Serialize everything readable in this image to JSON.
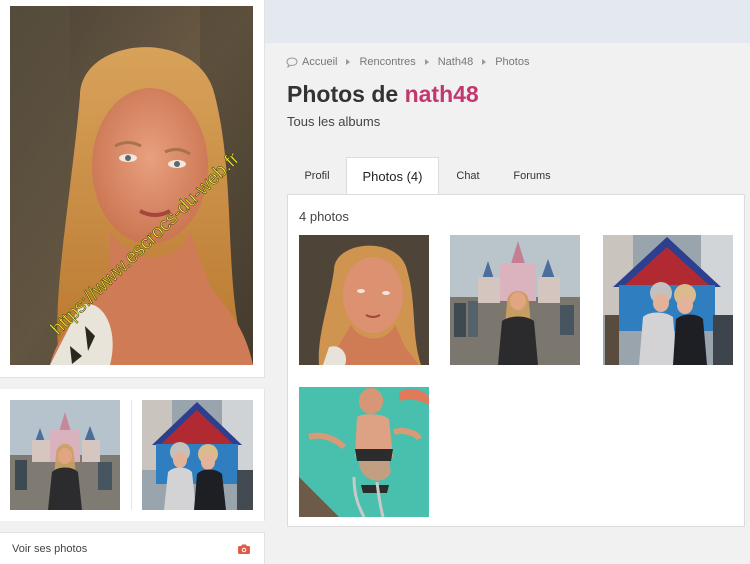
{
  "breadcrumb": [
    {
      "label": "Accueil"
    },
    {
      "label": "Rencontres"
    },
    {
      "label": "Nath48"
    },
    {
      "label": "Photos"
    }
  ],
  "page": {
    "title_prefix": "Photos de",
    "username": "nath48",
    "subtitle": "Tous les albums"
  },
  "tabs": [
    {
      "label": "Profil"
    },
    {
      "label": "Photos (4)"
    },
    {
      "label": "Chat"
    },
    {
      "label": "Forums"
    }
  ],
  "active_tab": "Photos (4)",
  "gallery": {
    "count_label": "4 photos"
  },
  "sidebar": {
    "see_photos_label": "Voir ses photos"
  },
  "watermark": "https://www.escrocs-du-web.fr",
  "colors": {
    "username": "#c2386e",
    "camera_icon": "#e05a4a",
    "topbar": "#e4e9ef"
  },
  "icons": {
    "breadcrumb_home": "speech-bubble-icon",
    "breadcrumb_separator": "triangle-right-icon",
    "see_photos": "camera-icon"
  }
}
